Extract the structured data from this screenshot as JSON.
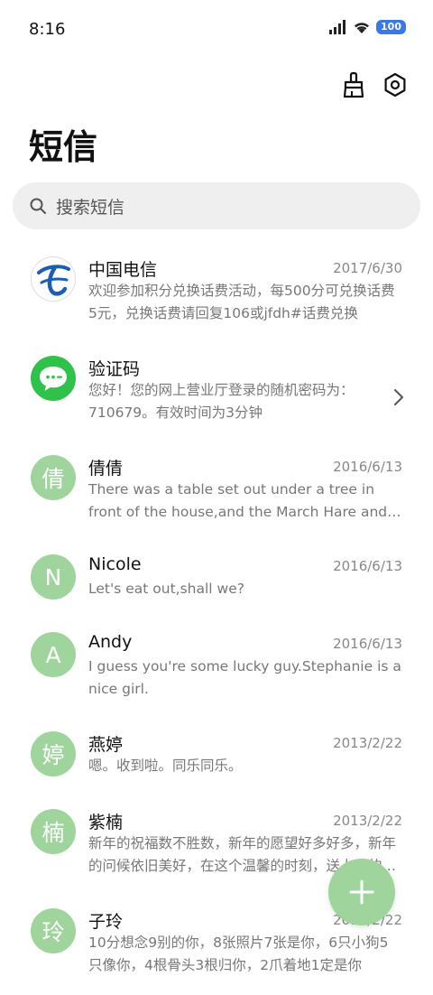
{
  "status": {
    "time": "8:16",
    "battery": "100"
  },
  "header": {
    "title": "短信"
  },
  "search": {
    "placeholder": "搜索短信"
  },
  "colors": {
    "avatar_bg": "#9fd59c",
    "fab_bg": "#9fd59c",
    "verify_bg": "#2fc24a",
    "telecom_blue": "#1a5fb4"
  },
  "messages": [
    {
      "avatar": "",
      "avatar_icon": "china-telecom-logo",
      "name": "中国电信",
      "date": "2017/6/30",
      "preview": "欢迎参加积分兑换话费活动，每500分可兑换话费5元，兑换话费请回复106或jfdh#话费兑换"
    },
    {
      "avatar": "",
      "avatar_icon": "message-bubble-icon",
      "name": "验证码",
      "date": "",
      "preview": "您好！您的网上营业厅登录的随机密码为：710679。有效时间为3分钟"
    },
    {
      "avatar": "倩",
      "name": "倩倩",
      "date": "2016/6/13",
      "preview": "There was a table set out under a tree in front of the house,and the March Hare and the Hatter were having tea"
    },
    {
      "avatar": "N",
      "name": "Nicole",
      "date": "2016/6/13",
      "preview": "Let's eat out,shall we?"
    },
    {
      "avatar": "A",
      "name": "Andy",
      "date": "2016/6/13",
      "preview": "I guess you're some lucky guy.Stephanie is a nice girl."
    },
    {
      "avatar": "婷",
      "name": "燕婷",
      "date": "2013/2/22",
      "preview": "嗯。收到啦。同乐同乐。"
    },
    {
      "avatar": "楠",
      "name": "紫楠",
      "date": "2013/2/22",
      "preview": "新年的祝福数不胜数，新年的愿望好多好多，新年的问候依旧美好，在这个温馨的时刻，送上我的祝福"
    },
    {
      "avatar": "玲",
      "name": "子玲",
      "date": "2013/2/22",
      "preview": "10分想念9别的你，8张照片7张是你，6只小狗5只像你，4根骨头3根归你，2爪着地1定是你"
    }
  ]
}
